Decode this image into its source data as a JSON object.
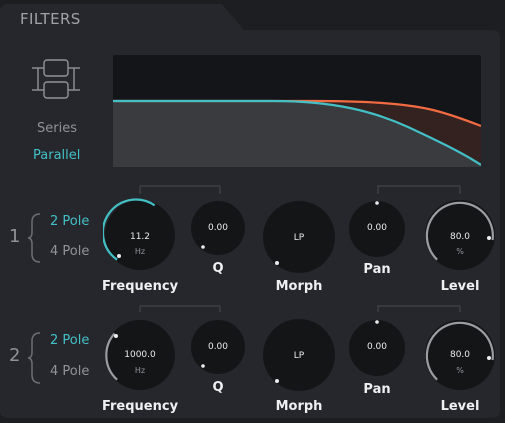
{
  "header": {
    "title": "FILTERS"
  },
  "routing": {
    "icon": "series-parallel-routing-icon",
    "options": [
      {
        "label": "Series",
        "selected": false
      },
      {
        "label": "Parallel",
        "selected": true
      }
    ]
  },
  "colors": {
    "background": "#1d1e22",
    "panel": "#26272c",
    "accent": "#43c0c6",
    "curve2": "#f26b42",
    "knob": "#141517"
  },
  "filters": [
    {
      "number": "1",
      "poles": [
        {
          "label": "2 Pole",
          "selected": true
        },
        {
          "label": "4 Pole",
          "selected": false
        }
      ],
      "frequency": {
        "label": "Frequency",
        "value": "11.2",
        "unit": "Hz"
      },
      "q": {
        "label": "Q",
        "value": "0.00"
      },
      "morph": {
        "label": "Morph",
        "value": "LP"
      },
      "pan": {
        "label": "Pan",
        "value": "0.00"
      },
      "level": {
        "label": "Level",
        "value": "80.0",
        "unit": "%"
      }
    },
    {
      "number": "2",
      "poles": [
        {
          "label": "2 Pole",
          "selected": true
        },
        {
          "label": "4 Pole",
          "selected": false
        }
      ],
      "frequency": {
        "label": "Frequency",
        "value": "1000.0",
        "unit": "Hz"
      },
      "q": {
        "label": "Q",
        "value": "0.00"
      },
      "morph": {
        "label": "Morph",
        "value": "LP"
      },
      "pan": {
        "label": "Pan",
        "value": "0.00"
      },
      "level": {
        "label": "Level",
        "value": "80.0",
        "unit": "%"
      }
    }
  ]
}
